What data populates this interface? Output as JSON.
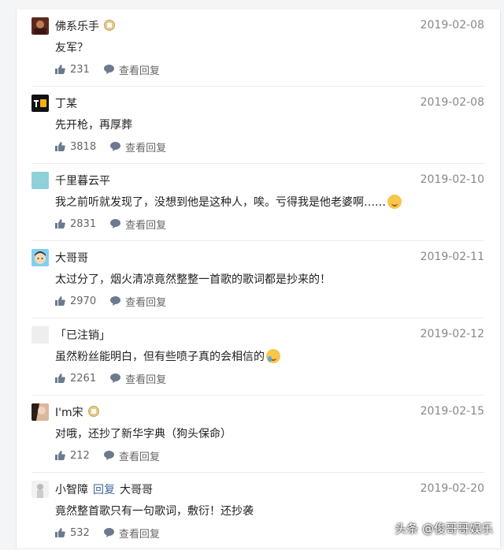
{
  "comments": [
    {
      "name": "佛系乐手",
      "badge": true,
      "date": "2019-02-08",
      "text": "友军？",
      "likes": "231",
      "reply_label": "查看回复",
      "avatar": "avatar-dark-photo"
    },
    {
      "name": "丁某",
      "badge": false,
      "date": "2019-02-08",
      "text": "先开枪，再厚葬",
      "likes": "3818",
      "reply_label": "查看回复",
      "avatar": "zhihu-logo-avatar"
    },
    {
      "name": "千里暮云平",
      "badge": false,
      "date": "2019-02-10",
      "text": "我之前听就发现了，没想到他是这种人，唉。亏得我是他老婆啊……",
      "likes": "2831",
      "reply_label": "查看回复",
      "avatar": "light-blue-avatar"
    },
    {
      "name": "大哥哥",
      "badge": false,
      "date": "2019-02-11",
      "text": "太过分了，烟火清凉竟然整整一首歌的歌词都是抄来的！",
      "likes": "2970",
      "reply_label": "查看回复",
      "avatar": "cartoon-boy-avatar"
    },
    {
      "name": "「已注销」",
      "badge": false,
      "date": "2019-02-12",
      "text": "虽然粉丝能明白，但有些喷子真的会相信的",
      "likes": "2261",
      "reply_label": "查看回复",
      "avatar": "blank-avatar"
    },
    {
      "name": "I'm宋",
      "badge": true,
      "date": "2019-02-15",
      "text": "对哦，还抄了新华字典（狗头保命）",
      "likes": "212",
      "reply_label": "查看回复",
      "avatar": "woman-photo-avatar"
    },
    {
      "name": "小智障",
      "reply_word": "回复",
      "reply_to": "大哥哥",
      "badge": false,
      "date": "2019-02-20",
      "text": "竟然整首歌只有一句歌词，敷衍！还抄袭",
      "likes": "532",
      "reply_label": "查看回复",
      "avatar": "figure-avatar"
    }
  ],
  "watermark": "头条 @俊哥哥娱乐",
  "colors": {
    "link": "#406599",
    "date": "#888888",
    "action": "#666666",
    "badge": "#e8c98a"
  }
}
